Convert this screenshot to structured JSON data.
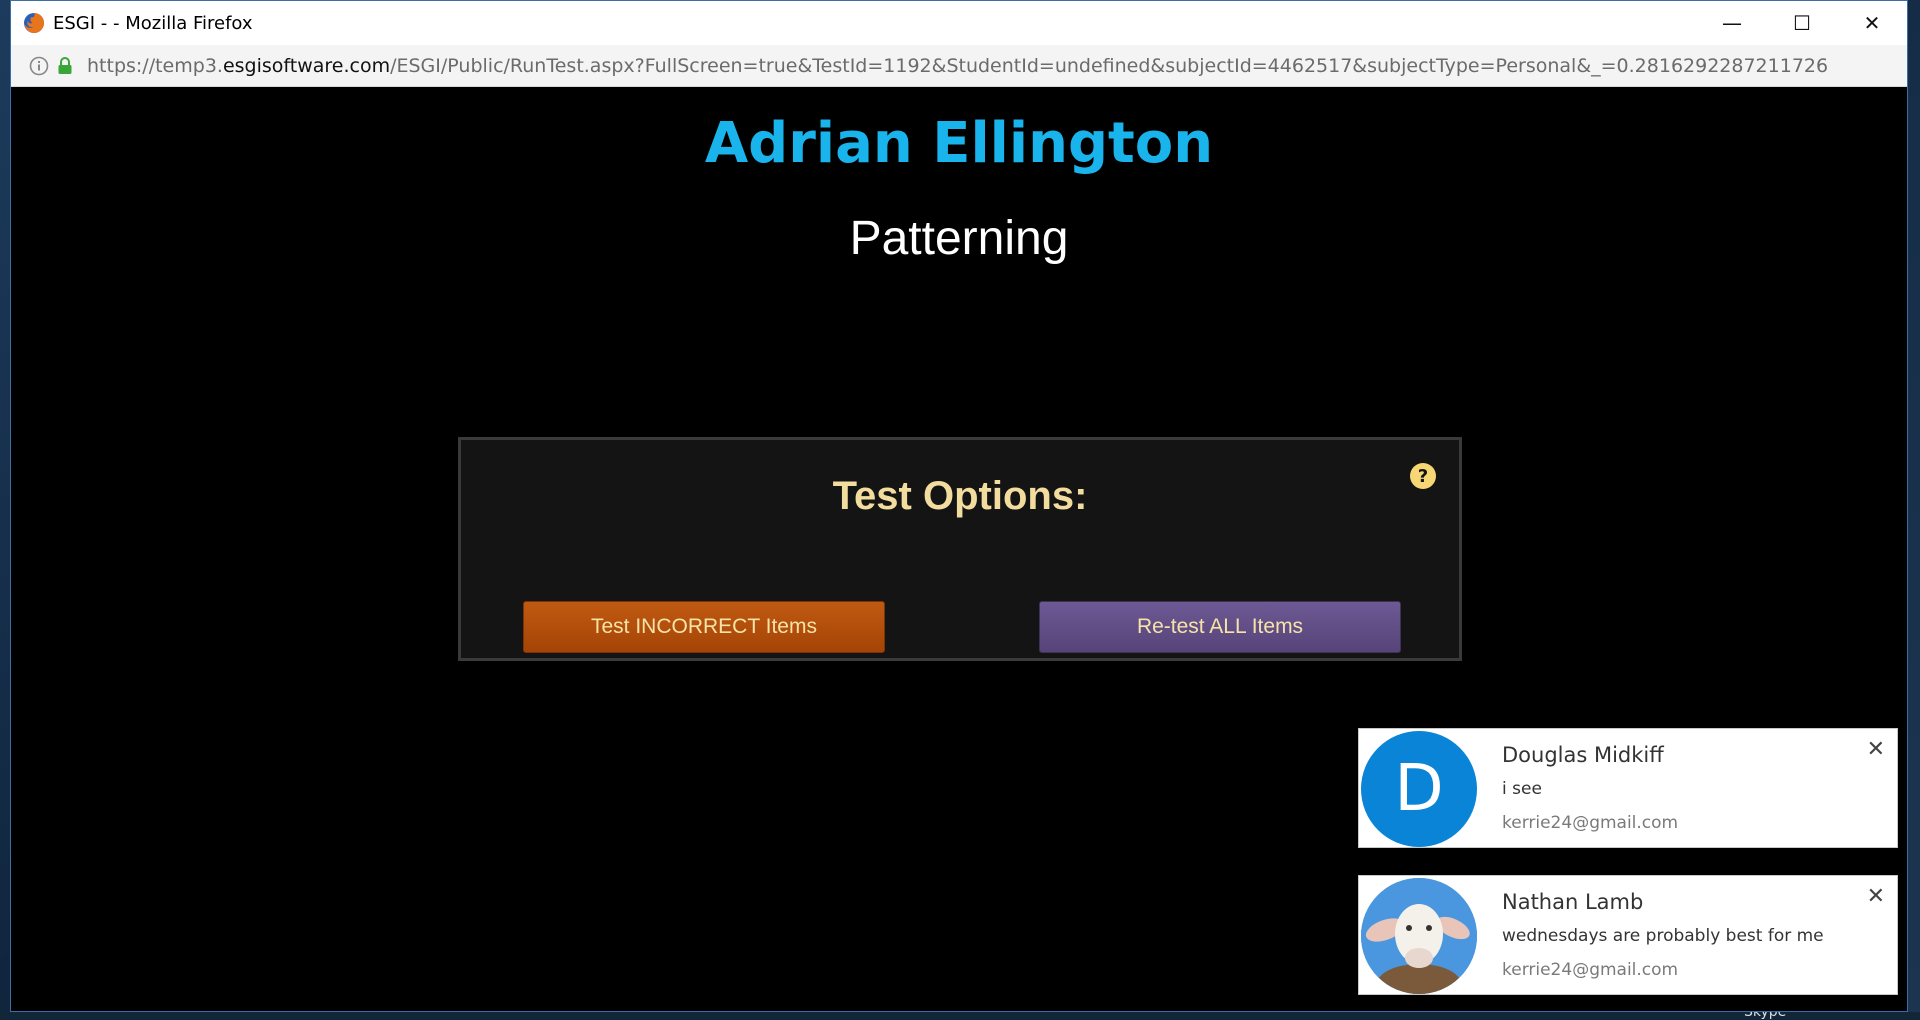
{
  "window": {
    "title": "ESGI - - Mozilla Firefox",
    "url_prefix": "https://temp3.",
    "url_domain": "esgisoftware.com",
    "url_path": "/ESGI/Public/RunTest.aspx?FullScreen=true&TestId=1192&StudentId=undefined&subjectId=4462517&subjectType=Personal&_=0.2816292287211726",
    "controls": {
      "minimize": "—",
      "maximize": "☐",
      "close": "✕"
    }
  },
  "page": {
    "student_name": "Adrian Ellington",
    "test_name": "Patterning",
    "options": {
      "title": "Test Options:",
      "help_icon": "question-circle-icon",
      "incorrect_button": "Test INCORRECT Items",
      "all_button": "Re-test ALL Items"
    }
  },
  "notifications": [
    {
      "name": "Douglas Midkiff",
      "message": "i see",
      "email": "kerrie24@gmail.com",
      "avatar_letter": "D",
      "close": "✕"
    },
    {
      "name": "Nathan Lamb",
      "message": "wednesdays are probably best for me",
      "email": "kerrie24@gmail.com",
      "close": "✕"
    }
  ],
  "desktop": {
    "skype_label": "Skype"
  },
  "colors": {
    "student_name": "#1ab4ec",
    "options_title": "#f2dd9e",
    "incorrect_button": "#b44f0c",
    "all_button": "#624f86",
    "avatar_letter_bg": "#0a84d6"
  }
}
